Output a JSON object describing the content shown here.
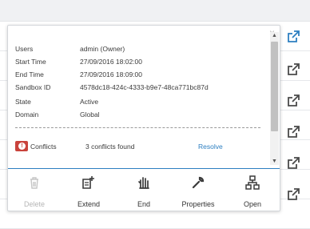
{
  "details": {
    "users_label": "Users",
    "users_value": "admin (Owner)",
    "start_label": "Start Time",
    "start_value": "27/09/2016 18:02:00",
    "end_label": "End Time",
    "end_value": "27/09/2016 18:09:00",
    "sandbox_label": "Sandbox ID",
    "sandbox_value": "4578dc18-424c-4333-b9e7-48ca771bc87d",
    "state_label": "State",
    "state_value": "Active",
    "domain_label": "Domain",
    "domain_value": "Global"
  },
  "conflicts": {
    "label": "Conflicts",
    "count_text": "3 conflicts found",
    "resolve_label": "Resolve"
  },
  "toolbar": {
    "delete_label": "Delete",
    "extend_label": "Extend",
    "end_label": "End",
    "properties_label": "Properties",
    "open_label": "Open"
  },
  "close_glyph": "×",
  "colors": {
    "accent": "#2d7fc1",
    "danger": "#c9433c",
    "disabled_text": "#b5b5b5"
  },
  "icons": {
    "row_action": "external-link-icon",
    "delete": "trash-icon",
    "extend": "extend-icon",
    "end": "hand-stop-icon",
    "properties": "wrench-icon",
    "open": "sitemap-icon"
  }
}
